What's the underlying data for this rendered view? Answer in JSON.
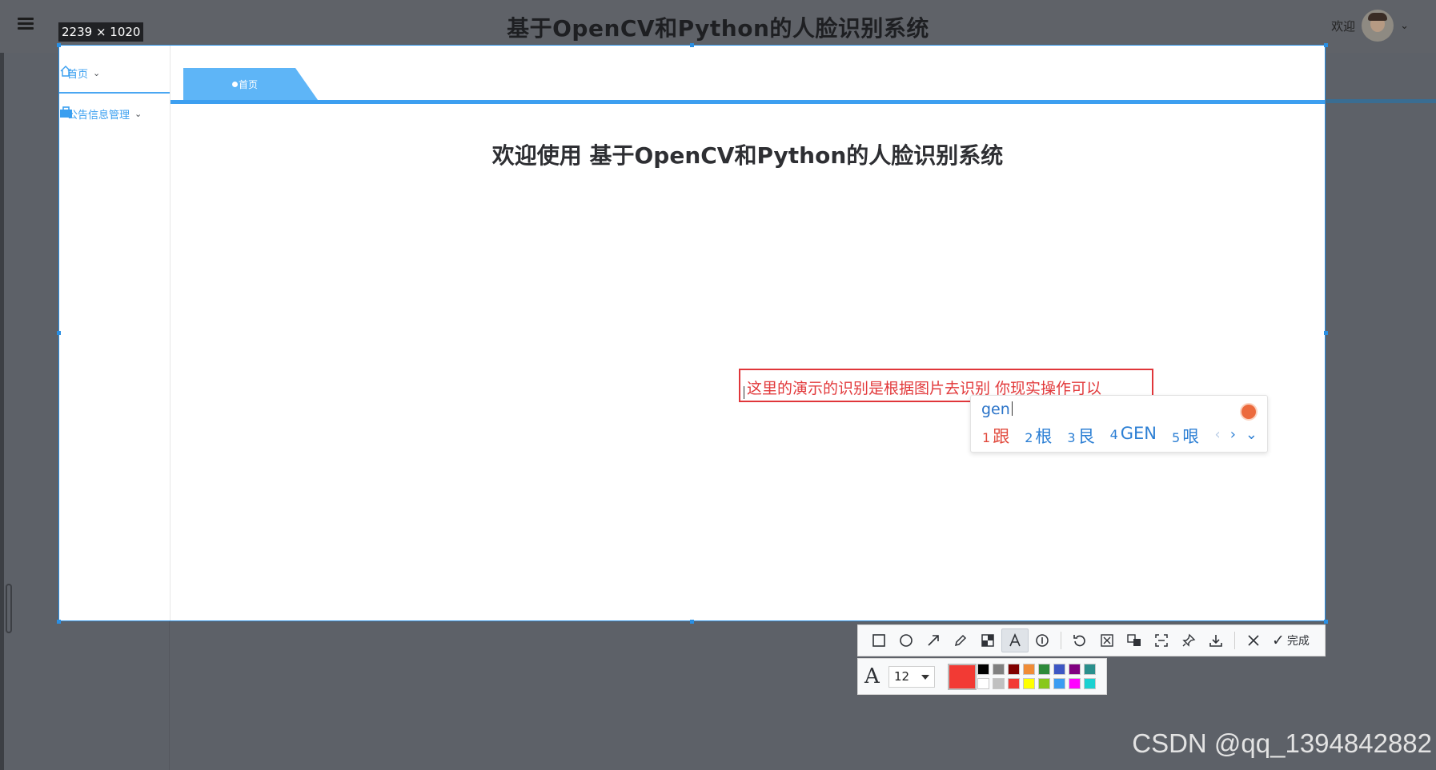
{
  "app": {
    "title": "基于OpenCV和Python的人脸识别系统",
    "welcome": "欢迎",
    "sidebar": [
      {
        "label": "首页",
        "icon": "home-icon"
      },
      {
        "label": "公告信息管理",
        "icon": "briefcase-icon"
      }
    ],
    "tab": {
      "label": "首页"
    },
    "main_title": "欢迎使用 基于OpenCV和Python的人脸识别系统"
  },
  "capture": {
    "size_label": "2239 × 1020",
    "annotation_text": "这里的演示的识别是根据图片去识别  你现实操作可以"
  },
  "ime": {
    "input": "gen",
    "candidates": [
      {
        "num": "1",
        "text": "跟"
      },
      {
        "num": "2",
        "text": "根"
      },
      {
        "num": "3",
        "text": "艮"
      },
      {
        "num": "4",
        "text": "GEN"
      },
      {
        "num": "5",
        "text": "哏"
      }
    ],
    "prev": "‹",
    "next": "›",
    "more": "⌄"
  },
  "toolbar": {
    "tools": [
      "rectangle-icon",
      "ellipse-icon",
      "arrow-icon",
      "pen-icon",
      "mosaic-icon",
      "text-icon",
      "number-icon",
      "undo-icon",
      "cut-icon",
      "translate-icon",
      "ocr-icon",
      "pin-icon",
      "download-icon",
      "close-icon"
    ],
    "done_label": "完成",
    "font_size": "12",
    "current_color": "#f23a34",
    "palette": [
      "#000000",
      "#808080",
      "#800000",
      "#f08c36",
      "#2d8a3a",
      "#3d57c4",
      "#800080",
      "#2a8f8c",
      "#ffffff",
      "#c0c0c0",
      "#f23a34",
      "#ffff00",
      "#88c81b",
      "#3a9cf2",
      "#ff00ff",
      "#1bd1d1"
    ]
  },
  "watermark": "CSDN @qq_1394842882"
}
